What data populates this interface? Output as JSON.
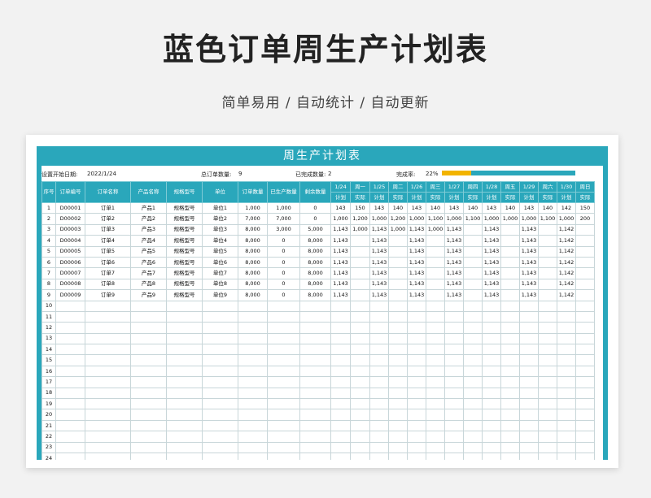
{
  "page": {
    "title": "蓝色订单周生产计划表",
    "subtitle": "简单易用 / 自动统计 / 自动更新"
  },
  "sheet": {
    "banner": "周生产计划表",
    "info": {
      "start_label": "设置开始日期:",
      "start_value": "2022/1/24",
      "total_label": "总订单数量:",
      "total_value": "9",
      "done_label": "已完成数量:",
      "done_value": "2",
      "rate_label": "完成率:",
      "rate_value": "22%",
      "rate_fraction": 0.22
    },
    "headers": {
      "fixed": [
        "序号",
        "订单编号",
        "订单名称",
        "产品名称",
        "规格型号",
        "单位",
        "订单数量",
        "已生产数量",
        "剩余数量"
      ],
      "dates": [
        "1/24",
        "周一",
        "1/25",
        "周二",
        "1/26",
        "周三",
        "1/27",
        "周四",
        "1/28",
        "周五",
        "1/29",
        "周六",
        "1/30",
        "周日"
      ],
      "sub": [
        "计划",
        "实际",
        "计划",
        "实际",
        "计划",
        "实际",
        "计划",
        "实际",
        "计划",
        "实际",
        "计划",
        "实际",
        "计划",
        "实际"
      ]
    },
    "rows": [
      [
        "1",
        "D00001",
        "订单1",
        "产品1",
        "规格型号",
        "单位1",
        "1,000",
        "1,000",
        "0",
        "143",
        "150",
        "143",
        "140",
        "143",
        "140",
        "143",
        "140",
        "143",
        "140",
        "143",
        "140",
        "142",
        "150"
      ],
      [
        "2",
        "D00002",
        "订单2",
        "产品2",
        "规格型号",
        "单位2",
        "7,000",
        "7,000",
        "0",
        "1,000",
        "1,200",
        "1,000",
        "1,200",
        "1,000",
        "1,100",
        "1,000",
        "1,100",
        "1,000",
        "1,000",
        "1,000",
        "1,100",
        "1,000",
        "200"
      ],
      [
        "3",
        "D00003",
        "订单3",
        "产品3",
        "规格型号",
        "单位3",
        "8,000",
        "3,000",
        "5,000",
        "1,143",
        "1,000",
        "1,143",
        "1,000",
        "1,143",
        "1,000",
        "1,143",
        "",
        "1,143",
        "",
        "1,143",
        "",
        "1,142",
        ""
      ],
      [
        "4",
        "D00004",
        "订单4",
        "产品4",
        "规格型号",
        "单位4",
        "8,000",
        "0",
        "8,000",
        "1,143",
        "",
        "1,143",
        "",
        "1,143",
        "",
        "1,143",
        "",
        "1,143",
        "",
        "1,143",
        "",
        "1,142",
        ""
      ],
      [
        "5",
        "D00005",
        "订单5",
        "产品5",
        "规格型号",
        "单位5",
        "8,000",
        "0",
        "8,000",
        "1,143",
        "",
        "1,143",
        "",
        "1,143",
        "",
        "1,143",
        "",
        "1,143",
        "",
        "1,143",
        "",
        "1,142",
        ""
      ],
      [
        "6",
        "D00006",
        "订单6",
        "产品6",
        "规格型号",
        "单位6",
        "8,000",
        "0",
        "8,000",
        "1,143",
        "",
        "1,143",
        "",
        "1,143",
        "",
        "1,143",
        "",
        "1,143",
        "",
        "1,143",
        "",
        "1,142",
        ""
      ],
      [
        "7",
        "D00007",
        "订单7",
        "产品7",
        "规格型号",
        "单位7",
        "8,000",
        "0",
        "8,000",
        "1,143",
        "",
        "1,143",
        "",
        "1,143",
        "",
        "1,143",
        "",
        "1,143",
        "",
        "1,143",
        "",
        "1,142",
        ""
      ],
      [
        "8",
        "D00008",
        "订单8",
        "产品8",
        "规格型号",
        "单位8",
        "8,000",
        "0",
        "8,000",
        "1,143",
        "",
        "1,143",
        "",
        "1,143",
        "",
        "1,143",
        "",
        "1,143",
        "",
        "1,143",
        "",
        "1,142",
        ""
      ],
      [
        "9",
        "D00009",
        "订单9",
        "产品9",
        "规格型号",
        "单位9",
        "8,000",
        "0",
        "8,000",
        "1,143",
        "",
        "1,143",
        "",
        "1,143",
        "",
        "1,143",
        "",
        "1,143",
        "",
        "1,143",
        "",
        "1,142",
        ""
      ]
    ],
    "empty_row_numbers": [
      "10",
      "11",
      "12",
      "13",
      "14",
      "15",
      "16",
      "17",
      "18",
      "19",
      "20",
      "21",
      "22",
      "23",
      "24"
    ],
    "colors": {
      "accent": "#2aa7bb",
      "progress": "#f2b400"
    }
  }
}
